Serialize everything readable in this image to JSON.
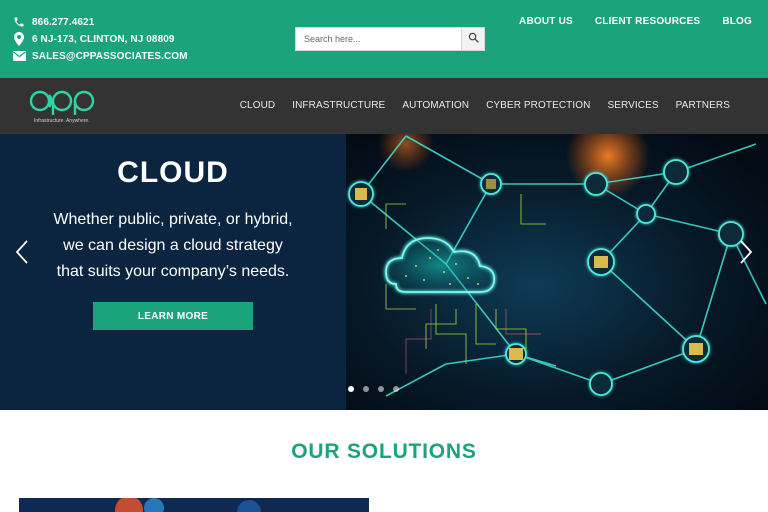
{
  "contact": {
    "phone": "866.277.4621",
    "address": "6 NJ-173, CLINTON, NJ 08809",
    "email": "SALES@CPPASSOCIATES.COM",
    "icons": [
      "phone-icon",
      "map-pin-icon",
      "envelope-icon"
    ]
  },
  "search": {
    "placeholder": "Search here...",
    "icon": "search-icon"
  },
  "top_nav": [
    "ABOUT US",
    "CLIENT RESOURCES",
    "BLOG"
  ],
  "logo": {
    "tagline": "Infrastructure. Anywhere."
  },
  "main_nav": [
    "CLOUD",
    "INFRASTRUCTURE",
    "AUTOMATION",
    "CYBER PROTECTION",
    "SERVICES",
    "PARTNERS"
  ],
  "hero": {
    "title": "CLOUD",
    "lines": [
      "Whether public, private, or hybrid,",
      "we can design a cloud strategy",
      "that suits your company’s needs."
    ],
    "button": "LEARN MORE",
    "slide_count": 4,
    "active_slide": 1
  },
  "solutions": {
    "title": "OUR SOLUTIONS"
  },
  "colors": {
    "brand_green": "#1aa37c",
    "nav_dark": "#333333",
    "hero_navy": "#0b2540",
    "accent_cyan": "#38e0d0"
  }
}
